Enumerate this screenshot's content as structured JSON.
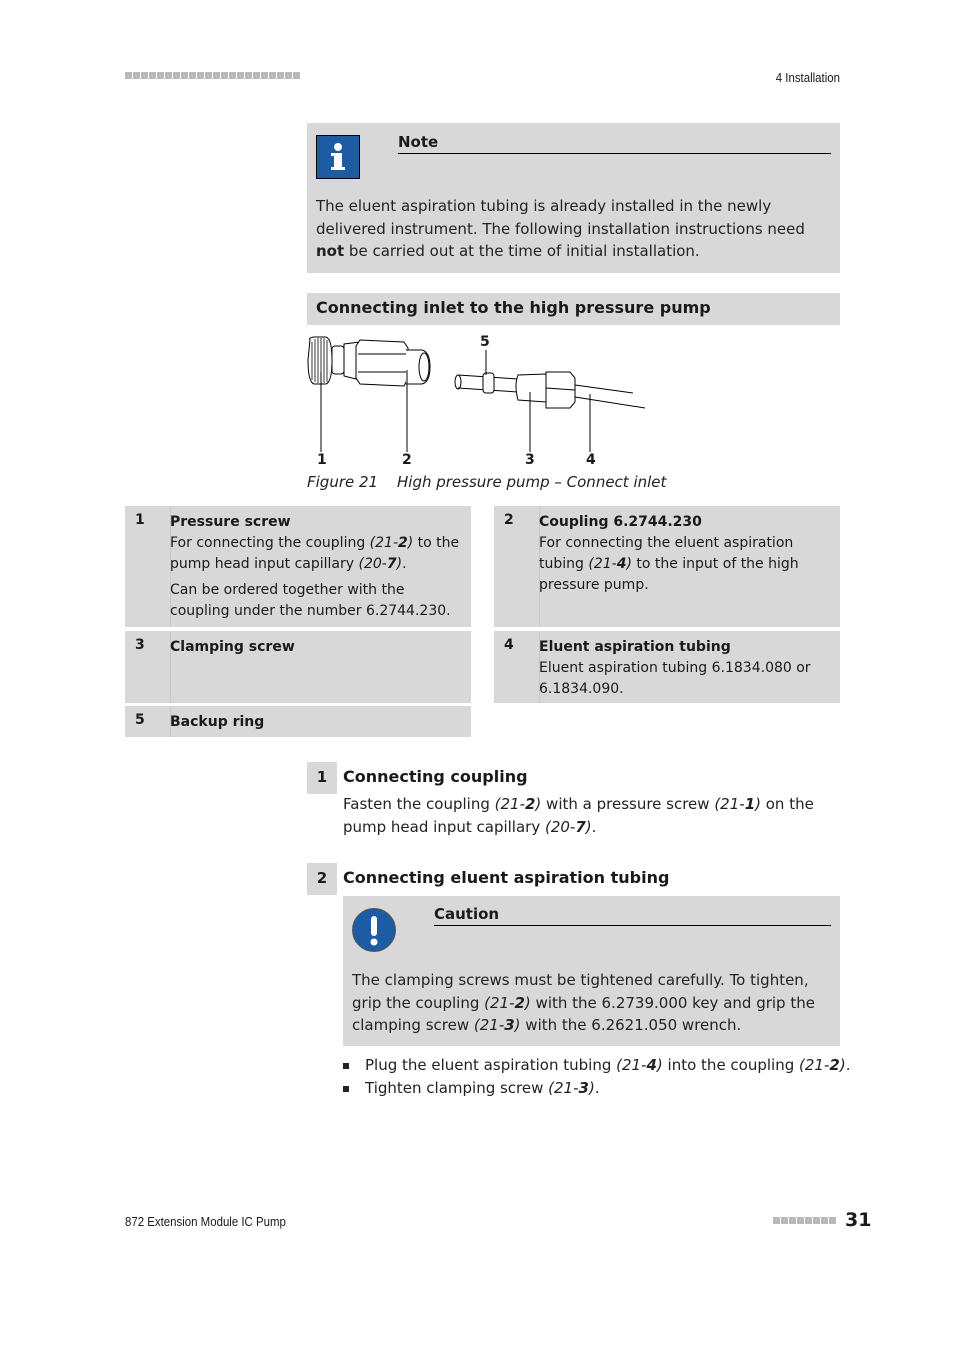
{
  "header": {
    "chapter": "4 Installation",
    "marker_squares": 22
  },
  "note": {
    "icon": "info-icon",
    "title": "Note",
    "text_before": "The eluent aspiration tubing is already installed in the newly delivered instrument. The following installation instructions need ",
    "text_bold": "not",
    "text_after": " be carried out at the time of initial installation."
  },
  "section": {
    "title": "Connecting inlet to the high pressure pump"
  },
  "figure": {
    "callouts": [
      "1",
      "2",
      "3",
      "4",
      "5"
    ],
    "caption_number": "Figure 21",
    "caption_text": "High pressure pump – Connect inlet"
  },
  "legend": [
    {
      "num": "1",
      "title": "Pressure screw",
      "p1": [
        "For connecting the coupling ",
        "(21-",
        "2",
        ")",
        " to the pump head input capillary ",
        "(20-",
        "7",
        ")",
        "."
      ],
      "p2": "Can be ordered together with the coupling under the number 6.2744.230."
    },
    {
      "num": "2",
      "title": "Coupling 6.2744.230",
      "p1": [
        "For connecting the eluent aspiration tubing ",
        "(21-",
        "4",
        ")",
        " to the input of the high pressure pump."
      ]
    },
    {
      "num": "3",
      "title": "Clamping screw"
    },
    {
      "num": "4",
      "title": "Eluent aspiration tubing",
      "text": "Eluent aspiration tubing 6.1834.080 or 6.1834.090."
    },
    {
      "num": "5",
      "title": "Backup ring"
    }
  ],
  "steps": [
    {
      "num": "1",
      "title": "Connecting coupling",
      "text": [
        "Fasten the coupling ",
        "(21-",
        "2",
        ")",
        " with a pressure screw ",
        "(21-",
        "1",
        ")",
        " on the pump head input capillary ",
        "(20-",
        "7",
        ")",
        "."
      ]
    },
    {
      "num": "2",
      "title": "Connecting eluent aspiration tubing"
    }
  ],
  "caution": {
    "icon": "exclamation-icon",
    "title": "Caution",
    "text": [
      "The clamping screws must be tightened carefully. To tighten, grip the coupling ",
      "(21-",
      "2",
      ")",
      " with the 6.2739.000 key and grip the clamp­ing screw ",
      "(21-",
      "3",
      ")",
      " with the 6.2621.050 wrench."
    ]
  },
  "bullets": [
    [
      "Plug the eluent aspiration tubing ",
      "(21-",
      "4",
      ")",
      " into the coupling ",
      "(21-",
      "2",
      ")",
      "."
    ],
    [
      "Tighten clamping screw ",
      "(21-",
      "3",
      ")",
      "."
    ]
  ],
  "footer": {
    "product": "872 Extension Module IC Pump",
    "page": "31",
    "marker_squares": 8
  }
}
